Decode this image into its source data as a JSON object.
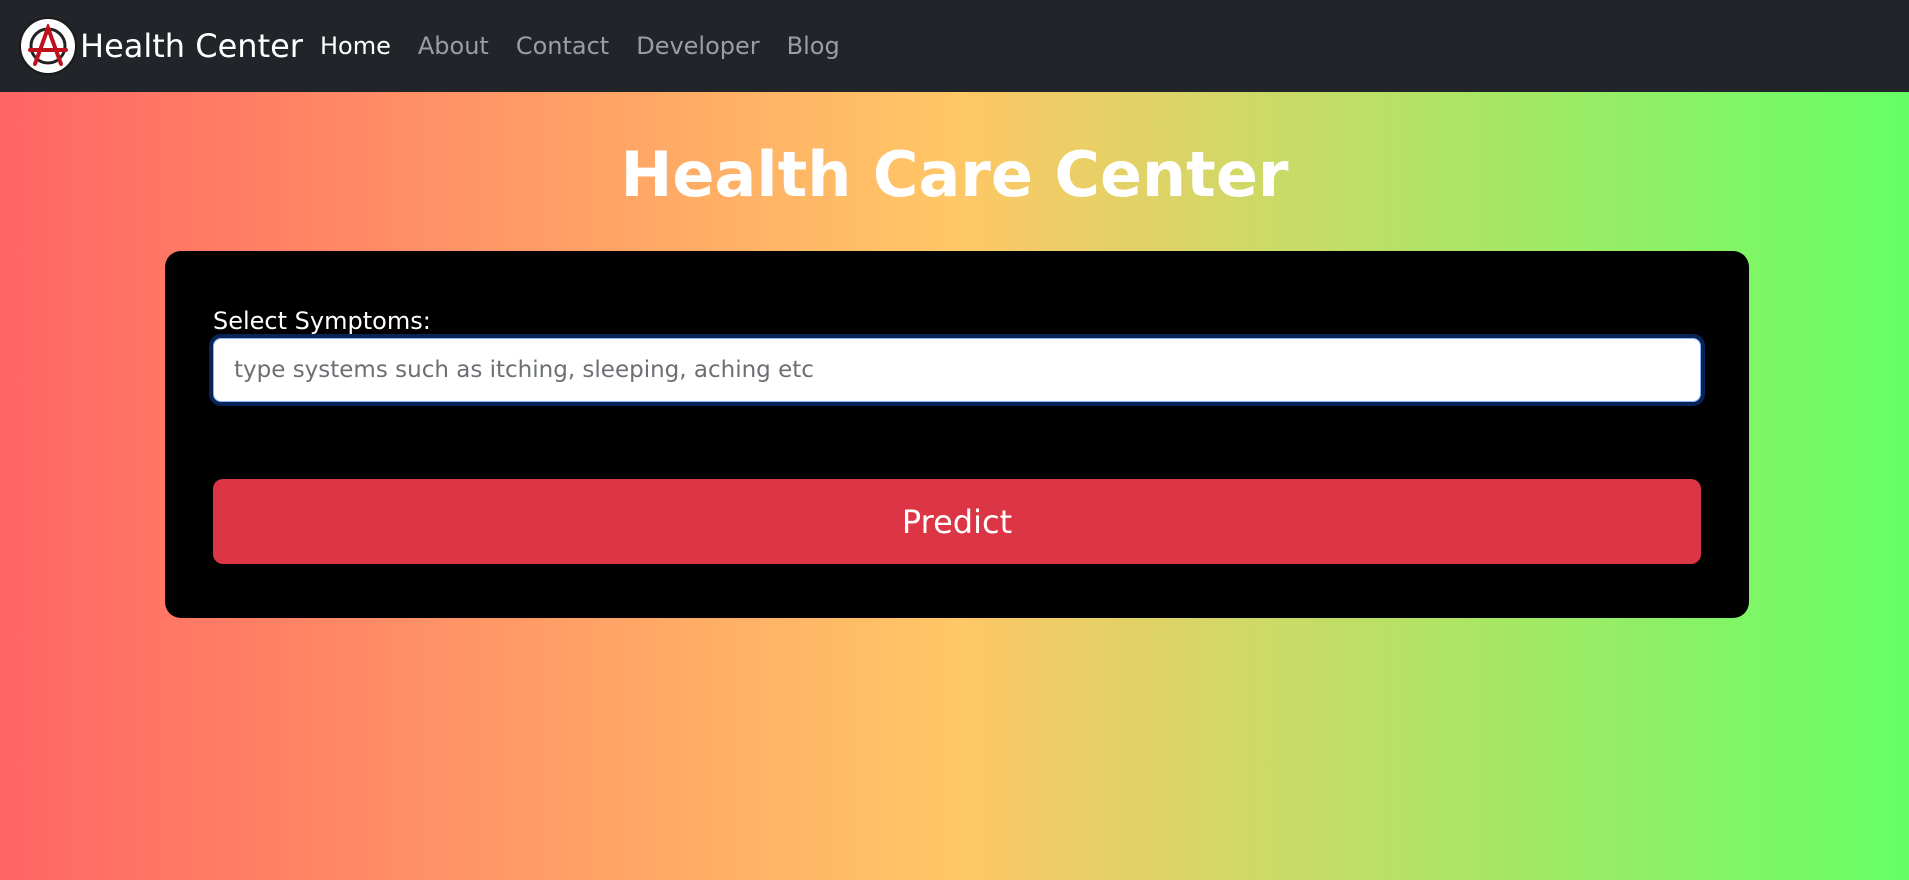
{
  "navbar": {
    "brand": "Health Center",
    "logo_icon": "anarchy-symbol-icon",
    "links": [
      {
        "label": "Home",
        "active": true
      },
      {
        "label": "About",
        "active": false
      },
      {
        "label": "Contact",
        "active": false
      },
      {
        "label": "Developer",
        "active": false
      },
      {
        "label": "Blog",
        "active": false
      }
    ]
  },
  "main": {
    "title": "Health Care Center",
    "symptoms_label": "Select Symptoms:",
    "symptoms_input": {
      "value": "",
      "placeholder": "type systems such as itching, sleeping, aching etc"
    },
    "predict_button": "Predict"
  },
  "colors": {
    "navbar_bg": "#212529",
    "gradient_left": "#ff6565",
    "gradient_mid": "#ffc766",
    "gradient_right": "#65ff65",
    "card_bg": "#000000",
    "button_bg": "#dc3545"
  }
}
